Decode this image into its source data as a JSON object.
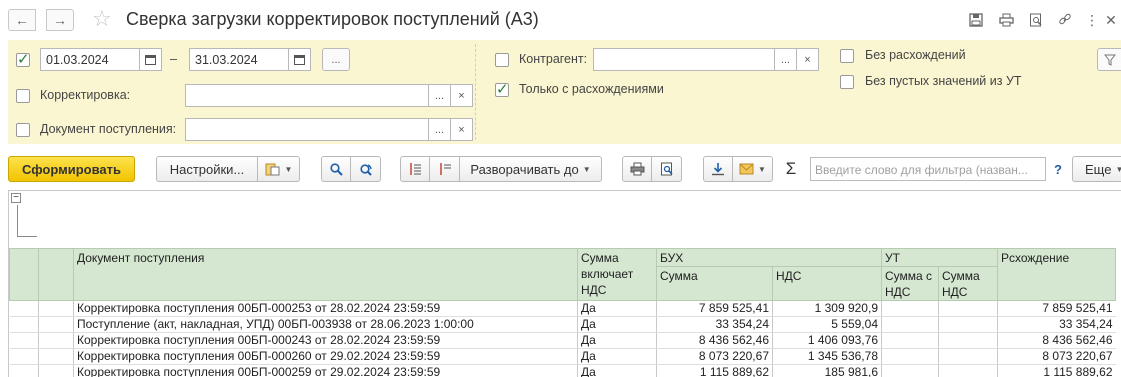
{
  "window": {
    "title": "Сверка загрузки корректировок поступлений (А3)"
  },
  "filters": {
    "period": {
      "from": "01.03.2024",
      "to": "31.03.2024",
      "dash": "–",
      "more": "..."
    },
    "correction_label": "Корректировка:",
    "receipt_doc_label": "Документ поступления:",
    "counterparty_label": "Контрагент:",
    "only_discrepancies_label": "Только с расхождениями",
    "no_discrepancies_label": "Без расхождений",
    "no_empty_ut_label": "Без пустых значений из УТ",
    "field_more": "...",
    "field_clear": "×"
  },
  "toolbar": {
    "generate_label": "Сформировать",
    "settings_label": "Настройки...",
    "expand_to_label": "Разворачивать до",
    "search_placeholder": "Введите слово для фильтра (назван...",
    "help_label": "?",
    "more_label": "Еще"
  },
  "report": {
    "header": {
      "doc": "Документ поступления",
      "sum_incl_vat": "Сумма включает НДС",
      "buh": "БУХ",
      "buh_sum": "Сумма",
      "buh_vat": "НДС",
      "ut": "УТ",
      "ut_sum_vat": "Сумма с НДС",
      "ut_vat": "Сумма НДС",
      "diff": "Рсхождение"
    },
    "rows": [
      {
        "doc": "Корректировка поступления 00БП-000253 от 28.02.2024 23:59:59",
        "incl": "Да",
        "sum": "7 859 525,41",
        "vat": "1 309 920,9",
        "ut_sum": "",
        "ut_vat": "",
        "diff": "7 859 525,41"
      },
      {
        "doc": "Поступление (акт, накладная, УПД) 00БП-003938 от 28.06.2023 1:00:00",
        "incl": "Да",
        "sum": "33 354,24",
        "vat": "5 559,04",
        "ut_sum": "",
        "ut_vat": "",
        "diff": "33 354,24"
      },
      {
        "doc": "Корректировка поступления 00БП-000243 от 28.02.2024 23:59:59",
        "incl": "Да",
        "sum": "8 436 562,46",
        "vat": "1 406 093,76",
        "ut_sum": "",
        "ut_vat": "",
        "diff": "8 436 562,46"
      },
      {
        "doc": "Корректировка поступления 00БП-000260 от 29.02.2024 23:59:59",
        "incl": "Да",
        "sum": "8 073 220,67",
        "vat": "1 345 536,78",
        "ut_sum": "",
        "ut_vat": "",
        "diff": "8 073 220,67"
      },
      {
        "doc": "Корректировка поступления 00БП-000259 от 29.02.2024 23:59:59",
        "incl": "Да",
        "sum": "1 115 889,62",
        "vat": "185 981,6",
        "ut_sum": "",
        "ut_vat": "",
        "diff": "1 115 889,62"
      }
    ]
  },
  "colors": {
    "filter_bg": "#fbf6d2",
    "primary_button": "#f2c400",
    "header_bg": "#d5e7d1",
    "check": "#2e7d32"
  }
}
